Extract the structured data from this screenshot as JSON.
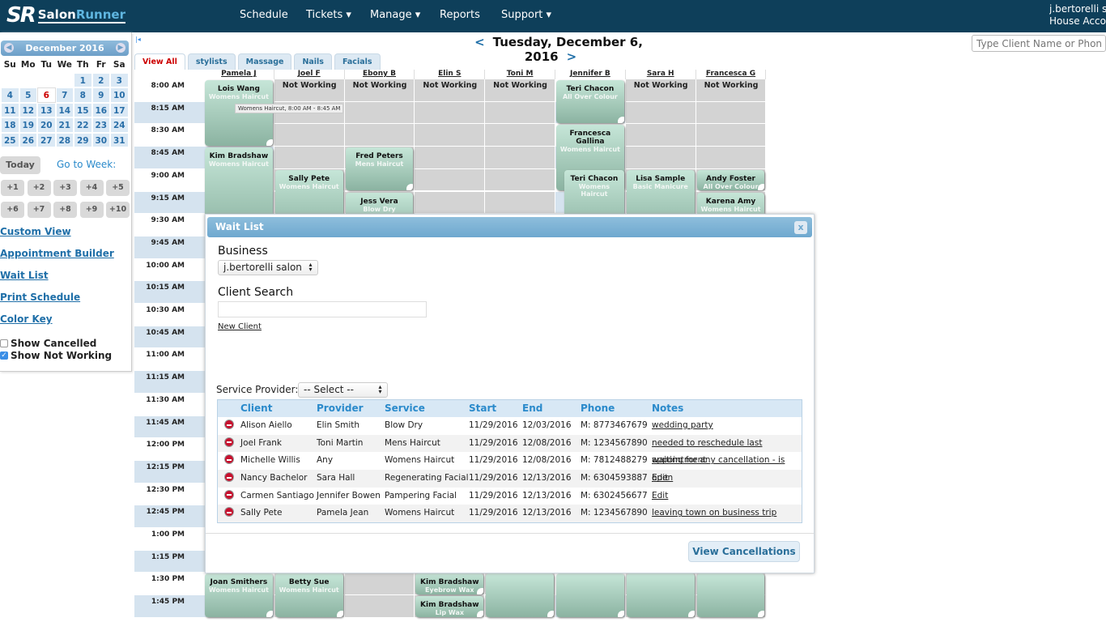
{
  "nav": {
    "logo": "SalonRunner",
    "logo_mark": "SR",
    "items": [
      "Schedule",
      "Tickets ▾",
      "Manage ▾",
      "Reports",
      "Support ▾"
    ],
    "account_name": "j.bertorelli salon",
    "account_sub": "House Account"
  },
  "search": {
    "placeholder": "Type Client Name or Phone"
  },
  "calendar": {
    "month": "December 2016",
    "weekdays": [
      "Su",
      "Mo",
      "Tu",
      "We",
      "Th",
      "Fr",
      "Sa"
    ],
    "first_weekday": 4,
    "days": 31,
    "selected": 6
  },
  "sidebar": {
    "today": "Today",
    "go_to_week": "Go to Week:",
    "week_buttons": [
      "+1",
      "+2",
      "+3",
      "+4",
      "+5",
      "+6",
      "+7",
      "+8",
      "+9",
      "+10"
    ],
    "links": [
      "Custom View",
      "Appointment Builder",
      "Wait List",
      "Print Schedule",
      "Color Key"
    ],
    "checks": [
      {
        "label": "Show Cancelled",
        "checked": false
      },
      {
        "label": "Show Not Working",
        "checked": true
      }
    ]
  },
  "schedule": {
    "date": "Tuesday, December 6, 2016",
    "prev": "<",
    "next": ">",
    "tabs": [
      "View All",
      "stylists",
      "Massage",
      "Nails",
      "Facials"
    ],
    "active_tab": "View All",
    "times": [
      "8:00 AM",
      "8:15 AM",
      "8:30 AM",
      "8:45 AM",
      "9:00 AM",
      "9:15 AM",
      "9:30 AM",
      "9:45 AM",
      "10:00 AM",
      "10:15 AM",
      "10:30 AM",
      "10:45 AM",
      "11:00 AM",
      "11:15 AM",
      "11:30 AM",
      "11:45 AM",
      "12:00 PM",
      "12:15 PM",
      "12:30 PM",
      "12:45 PM",
      "1:00 PM",
      "1:15 PM",
      "1:30 PM",
      "1:45 PM"
    ],
    "staff": [
      {
        "name": "Pamela J",
        "not_working": ""
      },
      {
        "name": "Joel F",
        "not_working": "Not Working"
      },
      {
        "name": "Ebony B",
        "not_working": "Not Working"
      },
      {
        "name": "Elin S",
        "not_working": "Not Working"
      },
      {
        "name": "Toni M",
        "not_working": "Not Working"
      },
      {
        "name": "Jennifer B",
        "not_working": ""
      },
      {
        "name": "Sara H",
        "not_working": "Not Working"
      },
      {
        "name": "Francesca G",
        "not_working": "Not Working"
      }
    ],
    "appointments": [
      {
        "staff": 0,
        "start": "8:00 AM",
        "minutes": 45,
        "client": "Lois Wang",
        "service": "Womens Haircut"
      },
      {
        "staff": 0,
        "start": "8:45 AM",
        "minutes": 60,
        "client": "Kim Bradshaw",
        "service": "Womens Haircut"
      },
      {
        "staff": 1,
        "start": "9:00 AM",
        "minutes": 45,
        "client": "Sally Pete",
        "service": "Womens Haircut"
      },
      {
        "staff": 2,
        "start": "8:45 AM",
        "minutes": 30,
        "client": "Fred Peters",
        "service": "Mens Haircut"
      },
      {
        "staff": 2,
        "start": "9:15 AM",
        "minutes": 30,
        "client": "Jess Vera",
        "service": "Blow Dry"
      },
      {
        "staff": 5,
        "start": "8:00 AM",
        "minutes": 30,
        "client": "Teri Chacon",
        "service": "All Over Colour"
      },
      {
        "staff": 5,
        "start": "8:30 AM",
        "minutes": 45,
        "client": "Francesca Gallina",
        "service": "Womens Haircut"
      },
      {
        "staff": 5,
        "start": "9:00 AM",
        "minutes": 45,
        "client": "Teri Chacon",
        "service": "Womens Haircut",
        "offset": true
      },
      {
        "staff": 6,
        "start": "9:00 AM",
        "minutes": 45,
        "client": "Lisa Sample",
        "service": "Basic Manicure"
      },
      {
        "staff": 7,
        "start": "9:00 AM",
        "minutes": 15,
        "client": "Andy Foster",
        "service": "All Over Colour"
      },
      {
        "staff": 7,
        "start": "9:15 AM",
        "minutes": 30,
        "client": "Karena Amy",
        "service": "Womens Haircut"
      },
      {
        "staff": 0,
        "start": "1:30 PM",
        "minutes": 30,
        "client": "Joan Smithers",
        "service": "Womens Haircut"
      },
      {
        "staff": 1,
        "start": "1:30 PM",
        "minutes": 30,
        "client": "Betty Sue",
        "service": "Womens Haircut"
      },
      {
        "staff": 3,
        "start": "1:30 PM",
        "minutes": 15,
        "client": "Kim Bradshaw",
        "service": "Eyebrow Wax"
      },
      {
        "staff": 3,
        "start": "1:45 PM",
        "minutes": 15,
        "client": "Kim Bradshaw",
        "service": "Lip Wax"
      },
      {
        "staff": 4,
        "start": "1:30 PM",
        "minutes": 30,
        "client": "",
        "service": ""
      },
      {
        "staff": 5,
        "start": "1:30 PM",
        "minutes": 30,
        "client": "",
        "service": ""
      },
      {
        "staff": 6,
        "start": "1:30 PM",
        "minutes": 30,
        "client": "",
        "service": ""
      },
      {
        "staff": 7,
        "start": "1:30 PM",
        "minutes": 30,
        "client": "",
        "service": ""
      }
    ],
    "tooltip": "Womens Haircut, 8:00 AM - 8:45 AM"
  },
  "waitlist": {
    "title": "Wait List",
    "close": "x",
    "business_label": "Business",
    "business_value": "j.bertorelli salon",
    "client_search_label": "Client Search",
    "client_search_value": "",
    "new_client": "New Client",
    "provider_label": "Service Provider:",
    "provider_value": "-- Select --",
    "columns": [
      "Client",
      "Provider",
      "Service",
      "Start",
      "End",
      "Phone",
      "Notes"
    ],
    "rows": [
      [
        "Alison Aiello",
        "Elin Smith",
        "Blow Dry",
        "11/29/2016",
        "12/03/2016",
        "M: 8773467679",
        "wedding party"
      ],
      [
        "Joel Frank",
        "Toni Martin",
        "Mens Haircut",
        "11/29/2016",
        "12/08/2016",
        "M: 1234567890",
        "needed to reschedule last appointment"
      ],
      [
        "Michelle Willis",
        "Any",
        "Womens Haircut",
        "11/29/2016",
        "12/08/2016",
        "M: 7812488279",
        "waiting for any cancellation - is open"
      ],
      [
        "Nancy Bachelor",
        "Sara Hall",
        "Regenerating Facial",
        "11/29/2016",
        "12/13/2016",
        "M: 6304593887",
        "Edit"
      ],
      [
        "Carmen Santiago",
        "Jennifer Bowen",
        "Pampering Facial",
        "11/29/2016",
        "12/13/2016",
        "M: 6302456677",
        "Edit"
      ],
      [
        "Sally Pete",
        "Pamela Jean",
        "Womens Haircut",
        "11/29/2016",
        "12/13/2016",
        "M: 1234567890",
        "leaving town on business trip"
      ]
    ],
    "view_cancellations": "View Cancellations"
  },
  "colors": {
    "nav": "#0e3f5a",
    "accent": "#2a8acb",
    "not_working": "#d3d3d3",
    "appointment": "#a9cfbe",
    "today": "#cc0000"
  }
}
